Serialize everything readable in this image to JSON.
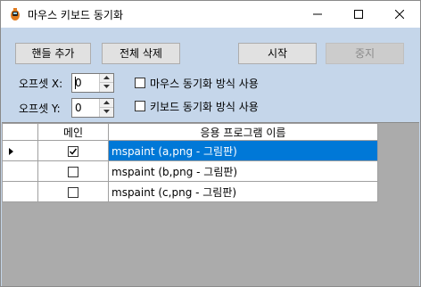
{
  "window": {
    "title": "마우스 키보드 동기화"
  },
  "toolbar": {
    "add_handle_label": "핸들 추가",
    "delete_all_label": "전체 삭제",
    "start_label": "시작",
    "stop_label": "중지"
  },
  "offsets": {
    "x_label": "오프셋 X:",
    "x_value": "0",
    "y_label": "오프셋 Y:",
    "y_value": "0"
  },
  "options": {
    "mouse_sync_label": "마우스 동기화 방식 사용",
    "mouse_sync_checked": false,
    "keyboard_sync_label": "키보드 동기화 방식 사용",
    "keyboard_sync_checked": false
  },
  "grid": {
    "columns": [
      "메인",
      "응용 프로그램 이름"
    ],
    "rows": [
      {
        "main": true,
        "app": "mspaint  (a,png - 그림판)",
        "selected": true
      },
      {
        "main": false,
        "app": "mspaint  (b,png - 그림판)",
        "selected": false
      },
      {
        "main": false,
        "app": "mspaint  (c,png - 그림판)",
        "selected": false
      }
    ]
  },
  "colors": {
    "client_bg": "#c5d6ea",
    "selection": "#0078d7",
    "grid_bg": "#ababab"
  }
}
